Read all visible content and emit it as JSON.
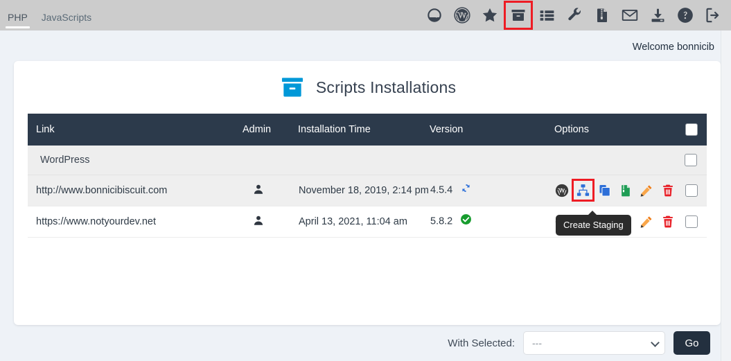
{
  "topbar": {
    "tabs": [
      {
        "label": "PHP",
        "active": true
      },
      {
        "label": "JavaScripts",
        "active": false
      }
    ],
    "icons": [
      {
        "name": "dashboard-icon",
        "title": "Dashboard"
      },
      {
        "name": "wordpress-icon",
        "title": "WordPress"
      },
      {
        "name": "star-icon",
        "title": "Favorites"
      },
      {
        "name": "box-archive-icon",
        "title": "Scripts Installations",
        "highlighted": true
      },
      {
        "name": "list-icon",
        "title": "List"
      },
      {
        "name": "wrench-icon",
        "title": "Settings"
      },
      {
        "name": "zip-file-icon",
        "title": "Backups"
      },
      {
        "name": "envelope-icon",
        "title": "Mail"
      },
      {
        "name": "download-icon",
        "title": "Import"
      },
      {
        "name": "help-icon",
        "title": "Help"
      },
      {
        "name": "logout-icon",
        "title": "Logout"
      }
    ],
    "background_color": "#cccccc",
    "highlight_color": "#ee1c24"
  },
  "welcome": "Welcome bonnicib",
  "card": {
    "title": "Scripts Installations",
    "title_icon": "box-archive-icon",
    "title_icon_color": "#0098d8"
  },
  "table": {
    "headers": {
      "link": "Link",
      "admin": "Admin",
      "time": "Installation Time",
      "version": "Version",
      "options": "Options",
      "select_all": ""
    },
    "header_background": "#2c3a4b",
    "groups": [
      {
        "name": "WordPress",
        "rows": [
          {
            "link": "http://www.bonnicibiscuit.com",
            "admin_icon": "user-icon",
            "time": "November 18, 2019, 2:14 pm",
            "version": "4.5.4",
            "version_status": "update-available",
            "version_status_icon": "refresh-icon",
            "version_status_color": "#2d6fd8",
            "options": [
              {
                "name": "wordpress-icon",
                "color": "#3a3a3a",
                "highlighted": false
              },
              {
                "name": "create-staging-icon",
                "color": "#2d6fd8",
                "highlighted": true
              },
              {
                "name": "clone-icon",
                "color": "#2d6fd8",
                "highlighted": false
              },
              {
                "name": "backup-icon",
                "color": "#1f9d55",
                "highlighted": false
              },
              {
                "name": "edit-icon",
                "color": "#ef7d1a",
                "highlighted": false
              },
              {
                "name": "delete-icon",
                "color": "#e81c24",
                "highlighted": false
              }
            ],
            "selected": false,
            "shaded": true
          },
          {
            "link": "https://www.notyourdev.net",
            "admin_icon": "user-icon",
            "time": "April 13, 2021, 11:04 am",
            "version": "5.8.2",
            "version_status": "up-to-date",
            "version_status_icon": "check-circle-icon",
            "version_status_color": "#179c2e",
            "options": [
              {
                "name": "wordpress-icon",
                "color": "#3a3a3a",
                "highlighted": false
              },
              {
                "name": "create-staging-icon",
                "color": "#2d6fd8",
                "highlighted": false
              },
              {
                "name": "clone-icon",
                "color": "#2d6fd8",
                "highlighted": false
              },
              {
                "name": "backup-icon",
                "color": "#1f9d55",
                "highlighted": false
              },
              {
                "name": "edit-icon",
                "color": "#ef7d1a",
                "highlighted": false
              },
              {
                "name": "delete-icon",
                "color": "#e81c24",
                "highlighted": false
              }
            ],
            "selected": false,
            "shaded": false
          }
        ]
      }
    ]
  },
  "tooltip": {
    "text": "Create Staging",
    "visible": true
  },
  "footer": {
    "with_selected_label": "With Selected:",
    "select_value": "---",
    "select_options": [
      "---"
    ],
    "go_label": "Go",
    "go_color": "#23303f"
  }
}
